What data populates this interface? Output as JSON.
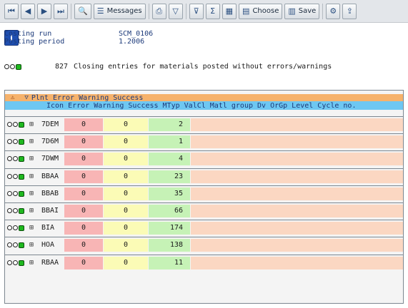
{
  "toolbar": {
    "buttons": [
      {
        "name": "first-page-button",
        "icon": "first-page-icon",
        "glyph": "⏮",
        "label": ""
      },
      {
        "name": "previous-page-button",
        "icon": "previous-page-icon",
        "glyph": "◀",
        "label": ""
      },
      {
        "name": "next-page-button",
        "icon": "next-page-icon",
        "glyph": "▶",
        "label": ""
      },
      {
        "name": "last-page-button",
        "icon": "last-page-icon",
        "glyph": "⏭",
        "label": ""
      },
      {
        "name": "find-button",
        "icon": "magnifier-icon",
        "glyph": "🔍",
        "label": ""
      },
      {
        "name": "messages-button",
        "icon": "messages-icon",
        "glyph": "☰",
        "label": "Messages"
      },
      {
        "name": "print-button",
        "icon": "printer-icon",
        "glyph": "⎙",
        "label": ""
      },
      {
        "name": "filter-button",
        "icon": "filter-icon",
        "glyph": "▽",
        "label": ""
      },
      {
        "name": "filter-options-button",
        "icon": "filter-options-icon",
        "glyph": "⊽",
        "label": ""
      },
      {
        "name": "sum-button",
        "icon": "sum-icon",
        "glyph": "Σ",
        "label": ""
      },
      {
        "name": "layout-button",
        "icon": "layout-icon",
        "glyph": "▦",
        "label": ""
      },
      {
        "name": "choose-button",
        "icon": "choose-layout-icon",
        "glyph": "▤",
        "label": "Choose"
      },
      {
        "name": "save-button",
        "icon": "save-layout-icon",
        "glyph": "▥",
        "label": "Save"
      },
      {
        "name": "settings-button",
        "icon": "settings-icon",
        "glyph": "⚙",
        "label": ""
      },
      {
        "name": "export-button",
        "icon": "export-icon",
        "glyph": "⇪",
        "label": ""
      },
      {
        "name": "info-button",
        "icon": "info-icon",
        "glyph": "i",
        "label": ""
      }
    ]
  },
  "header": {
    "costing_run_label": "Costing run",
    "costing_run_value": "SCM_0106",
    "posting_period_label": "Posting period",
    "posting_period_value": "1.2006"
  },
  "summary": {
    "count": "827",
    "message": "Closing entries for materials posted without errors/warnings"
  },
  "grid": {
    "header_row1": {
      "warning_glyph": "⚠",
      "filter_glyph": "▽",
      "text": "Plnt Error Warning Success"
    },
    "header_row2": {
      "text": "Icon Error Warning Success MTyp ValCl Matl group Dv OrGp Level Cycle no."
    },
    "material_icon_glyph": "⊞",
    "rows": [
      {
        "plant": "7DEM",
        "error": "0",
        "warning": "0",
        "success": "2"
      },
      {
        "plant": "7D6M",
        "error": "0",
        "warning": "0",
        "success": "1"
      },
      {
        "plant": "7DWM",
        "error": "0",
        "warning": "0",
        "success": "4"
      },
      {
        "plant": "BBAA",
        "error": "0",
        "warning": "0",
        "success": "23"
      },
      {
        "plant": "BBAB",
        "error": "0",
        "warning": "0",
        "success": "35"
      },
      {
        "plant": "BBAI",
        "error": "0",
        "warning": "0",
        "success": "66"
      },
      {
        "plant": "BIA",
        "error": "0",
        "warning": "0",
        "success": "174"
      },
      {
        "plant": "HOA",
        "error": "0",
        "warning": "0",
        "success": "138"
      },
      {
        "plant": "RBAA",
        "error": "0",
        "warning": "0",
        "success": "11"
      }
    ]
  },
  "colors": {
    "error_cell": "#f8b5b5",
    "warning_cell": "#fbfbb6",
    "success_cell": "#c6f2b6",
    "header_orange": "#f6b26b",
    "header_blue": "#6ec7f2",
    "status_green": "#1fb81f"
  }
}
